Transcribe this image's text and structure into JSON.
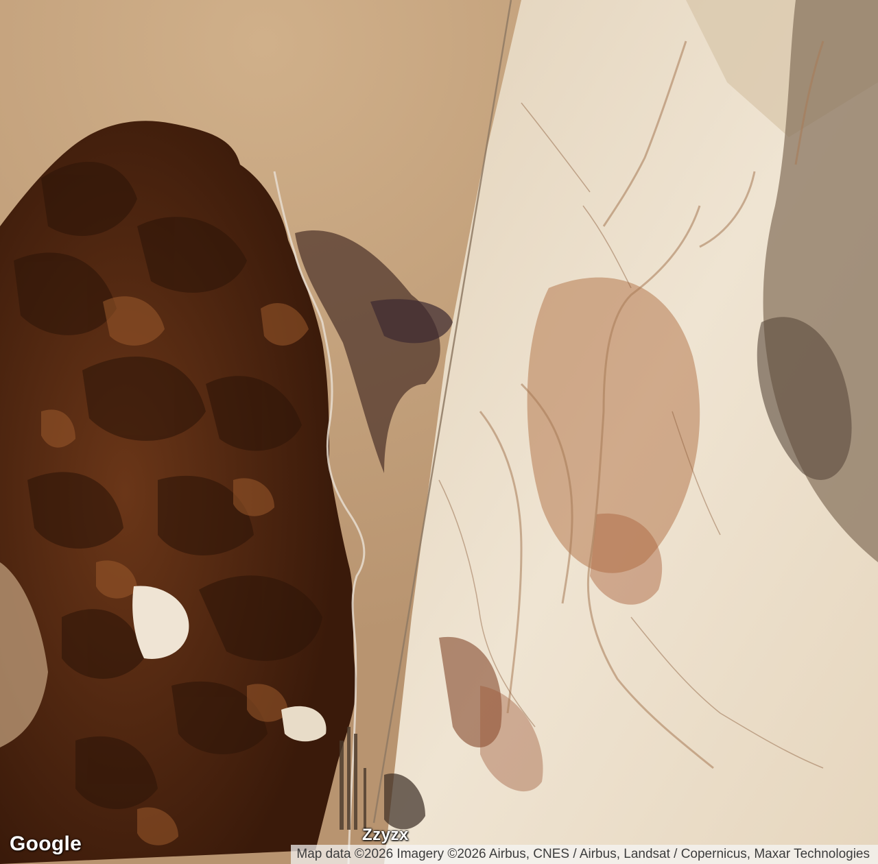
{
  "map": {
    "type": "satellite",
    "place_label": "Zzyzx",
    "logo": "Google",
    "attribution": "Map data ©2026 Imagery ©2026 Airbus, CNES / Airbus, Landsat / Copernicus, Maxar Technologies"
  },
  "colors": {
    "desert_fan": "#c4a27c",
    "mountains": "#5a2e14",
    "mountain_dark": "#2e1508",
    "salt_flat": "#e9dcc7",
    "clay_red": "#a8603a",
    "label_text": "#ffffff"
  }
}
